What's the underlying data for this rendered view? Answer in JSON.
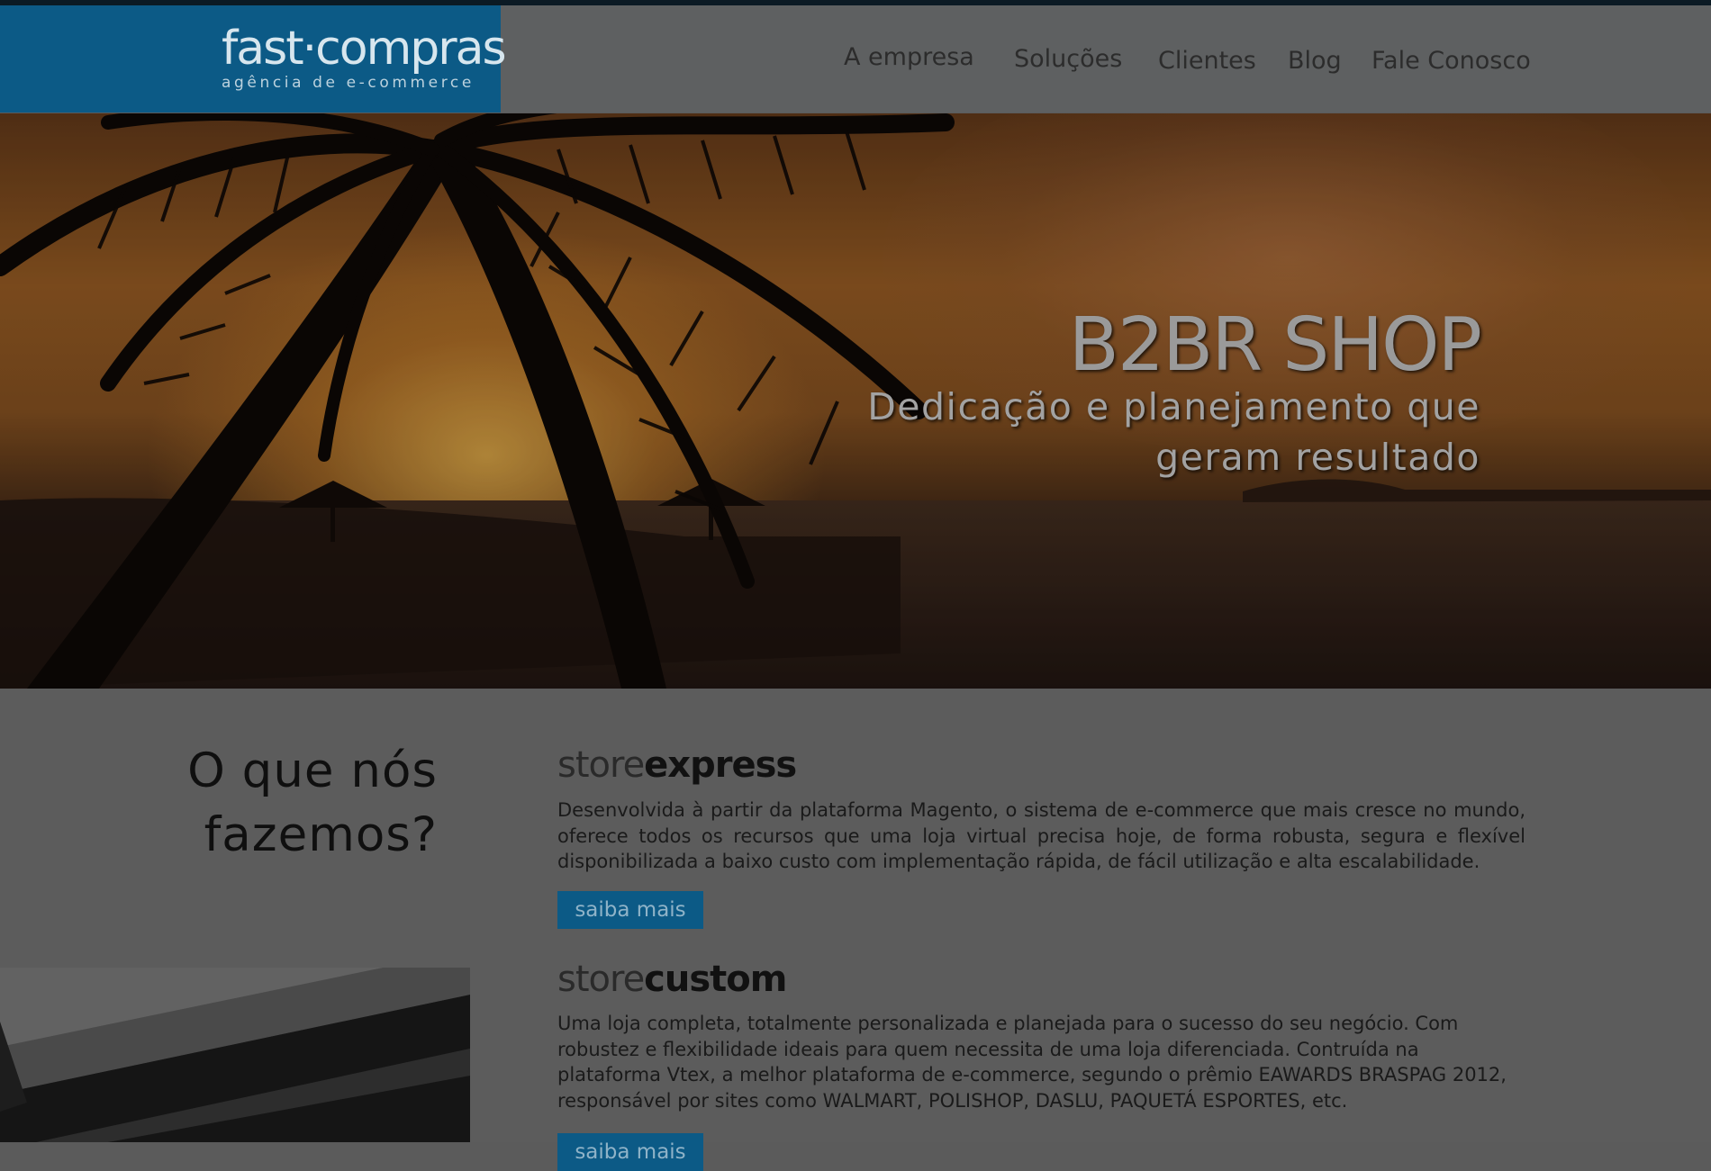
{
  "header": {
    "logo": {
      "main": "fast·compras",
      "tagline": "agência de e-commerce"
    },
    "nav": [
      "A empresa",
      "Soluções",
      "Clientes",
      "Blog",
      "Fale Conosco"
    ]
  },
  "hero": {
    "title": "B2BR SHOP",
    "subtitle": "Dedicação e planejamento que geram resultado"
  },
  "main": {
    "heading": "O que nós fazemos?",
    "products": [
      {
        "name_light": "store",
        "name_bold": "express",
        "description": "Desenvolvida à partir da plataforma Magento, o sistema de e-commerce que mais cresce no mundo, oferece todos os recursos que uma loja virtual precisa hoje, de forma robusta, segura e flexível disponibilizada a baixo custo com implementação rápida, de fácil utilização e alta escalabilidade.",
        "button": "saiba mais"
      },
      {
        "name_light": "store",
        "name_bold": "custom",
        "description": "Uma loja completa, totalmente personalizada e planejada para o sucesso do seu negócio. Com robustez e flexibilidade ideais para quem necessita de uma loja diferenciada. Contruída na plataforma Vtex, a melhor plataforma de e-commerce, segundo o prêmio EAWARDS BRASPAG 2012, responsável por sites como WALMART, POLISHOP, DASLU, PAQUETÁ ESPORTES, etc.",
        "button": "saiba mais"
      }
    ]
  },
  "colors": {
    "brand_blue": "#0c5a86",
    "overlay_gray": "#5c5c5c",
    "top_line": "#0b1a24"
  }
}
